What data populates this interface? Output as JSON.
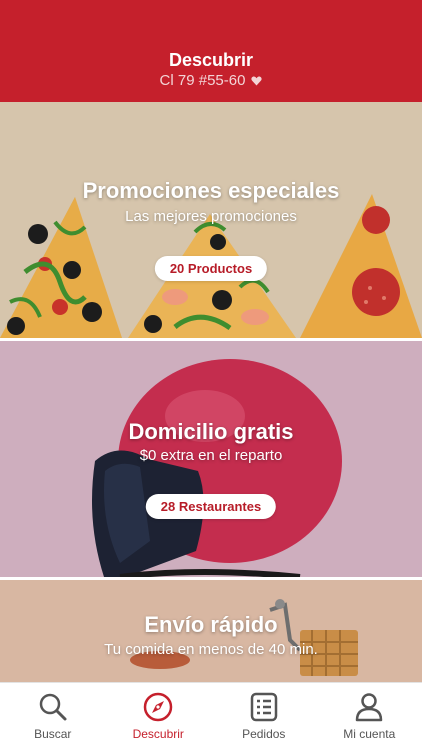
{
  "header": {
    "title": "Descubrir",
    "address": "Cl 79 #55-60"
  },
  "cards": [
    {
      "title": "Promociones especiales",
      "subtitle": "Las mejores promociones",
      "badge": "20 Productos"
    },
    {
      "title": "Domicilio gratis",
      "subtitle": "$0 extra en el reparto",
      "badge": "28 Restaurantes"
    },
    {
      "title": "Envío rápido",
      "subtitle": "Tu comida en menos de 40 min."
    }
  ],
  "tabs": [
    {
      "label": "Buscar",
      "icon": "search-icon",
      "active": false
    },
    {
      "label": "Descubrir",
      "icon": "compass-icon",
      "active": true
    },
    {
      "label": "Pedidos",
      "icon": "receipt-icon",
      "active": false
    },
    {
      "label": "Mi cuenta",
      "icon": "user-icon",
      "active": false
    }
  ],
  "colors": {
    "brand": "#c5202c",
    "inactive": "#555555"
  }
}
